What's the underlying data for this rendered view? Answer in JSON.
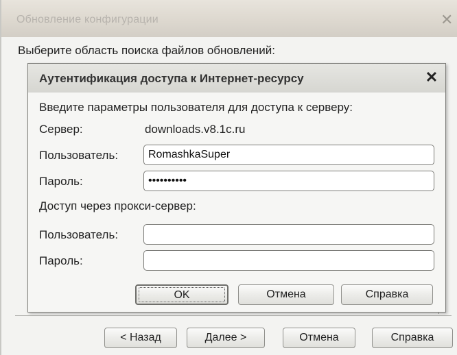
{
  "window": {
    "title": "Обновление конфигурации",
    "close_glyph": "✕",
    "prompt": "Выберите область поиска файлов обновлений:"
  },
  "wizard_buttons": {
    "back": "< Назад",
    "next": "Далее >",
    "cancel": "Отмена",
    "help": "Справка"
  },
  "dialog": {
    "title": "Аутентификация доступа к Интернет-ресурсу",
    "close_glyph": "✕",
    "intro": "Введите параметры пользователя для доступа к серверу:",
    "server_label": "Сервер:",
    "server_value": "downloads.v8.1c.ru",
    "user_label": "Пользователь:",
    "user_value": "RomashkaSuper",
    "password_label": "Пароль:",
    "password_value": "SecretPass",
    "proxy_heading": "Доступ через прокси-сервер:",
    "proxy_user_label": "Пользователь:",
    "proxy_user_value": "",
    "proxy_password_label": "Пароль:",
    "proxy_password_value": "",
    "ok": "OK",
    "cancel": "Отмена",
    "help": "Справка"
  }
}
